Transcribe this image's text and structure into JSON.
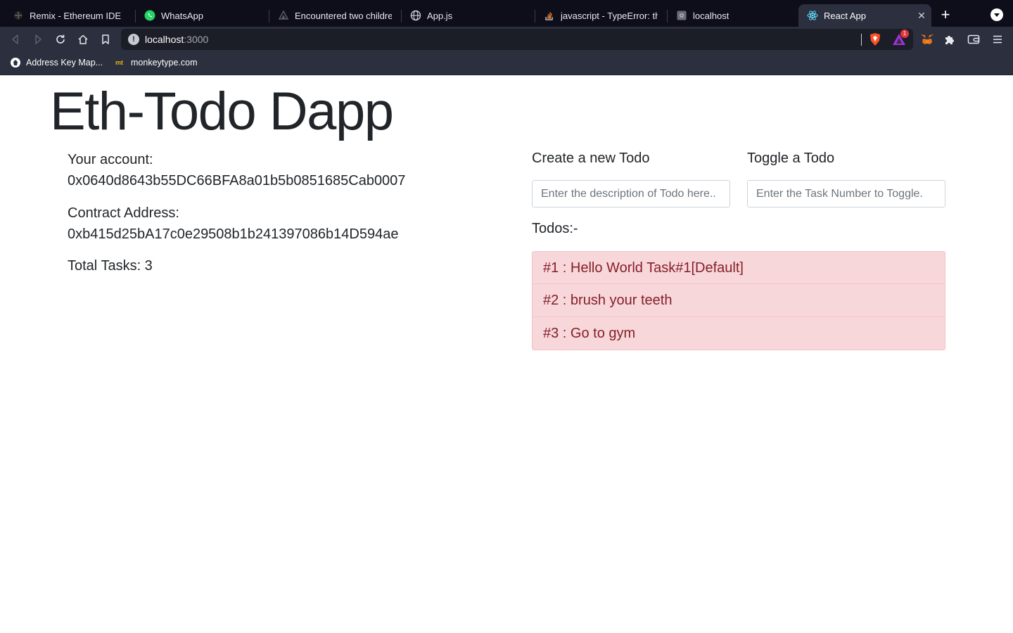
{
  "browser": {
    "tabs": [
      {
        "label": "Remix - Ethereum IDE",
        "icon": "remix-icon",
        "active": false
      },
      {
        "label": "WhatsApp",
        "icon": "whatsapp-icon",
        "active": false
      },
      {
        "label": "Encountered two children w",
        "icon": "vercel-icon",
        "active": false
      },
      {
        "label": "App.js",
        "icon": "globe-icon",
        "active": false
      },
      {
        "label": "javascript - TypeError: this.",
        "icon": "stackoverflow-icon",
        "active": false
      },
      {
        "label": "localhost",
        "icon": "page-icon",
        "active": false
      },
      {
        "label": "React App",
        "icon": "react-icon",
        "active": true
      }
    ],
    "address": {
      "host": "localhost",
      "port": ":3000"
    },
    "extension_badge": "1",
    "bookmarks": [
      {
        "label": "Address Key Map...",
        "icon": "bookmark-favicon"
      },
      {
        "label": "monkeytype.com",
        "icon_text": "mt"
      }
    ]
  },
  "app": {
    "title": "Eth-Todo Dapp",
    "account_label": "Your account:",
    "account_value": "0x0640d8643b55DC66BFA8a01b5b0851685Cab0007",
    "contract_label": "Contract Address:",
    "contract_value": "0xb415d25bA17c0e29508b1b241397086b14D594ae",
    "total_tasks": "Total Tasks: 3",
    "create_label": "Create a new Todo",
    "create_placeholder": "Enter the description of Todo here..",
    "toggle_label": "Toggle a Todo",
    "toggle_placeholder": "Enter the Task Number to Toggle.",
    "todos_label": "Todos:-",
    "todos": [
      "#1 : Hello World Task#1[Default]",
      "#2 : brush your teeth",
      "#3 : Go to gym"
    ]
  },
  "colors": {
    "tabstrip": "#0e0e1b",
    "toolbar": "#2b2f3e",
    "todo_bg": "#f8d7da",
    "todo_text": "#842029"
  }
}
